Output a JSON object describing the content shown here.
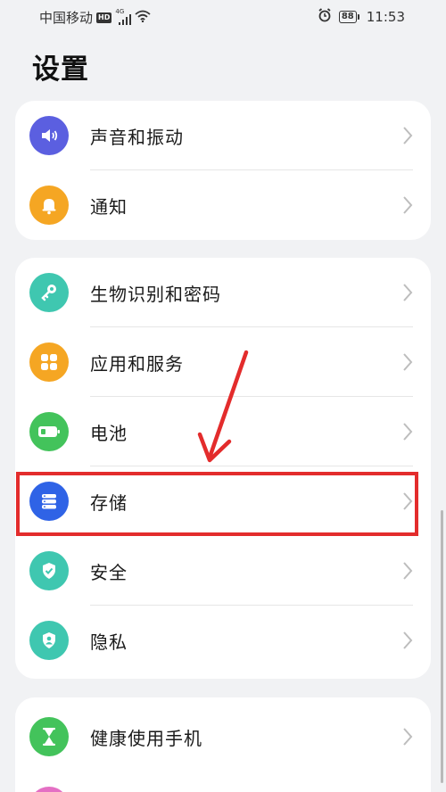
{
  "status_bar": {
    "carrier": "中国移动",
    "hd": "HD",
    "network": "4G",
    "battery": "88",
    "time": "11:53"
  },
  "page": {
    "title": "设置"
  },
  "groups": [
    {
      "items": [
        {
          "label": "声音和振动",
          "icon": "volume-icon",
          "color": "#5b5fe0"
        },
        {
          "label": "通知",
          "icon": "bell-icon",
          "color": "#f5a623"
        }
      ]
    },
    {
      "items": [
        {
          "label": "生物识别和密码",
          "icon": "key-icon",
          "color": "#3fc7b0"
        },
        {
          "label": "应用和服务",
          "icon": "apps-icon",
          "color": "#f5a623"
        },
        {
          "label": "电池",
          "icon": "battery-icon",
          "color": "#43c35b"
        },
        {
          "label": "存储",
          "icon": "storage-icon",
          "color": "#2f63e6",
          "highlighted": true
        },
        {
          "label": "安全",
          "icon": "shield-icon",
          "color": "#3fc7b0"
        },
        {
          "label": "隐私",
          "icon": "privacy-icon",
          "color": "#3fc7b0"
        }
      ]
    },
    {
      "items": [
        {
          "label": "健康使用手机",
          "icon": "hourglass-icon",
          "color": "#43c35b"
        }
      ]
    }
  ],
  "annotation": {
    "color": "#e32c2c"
  }
}
